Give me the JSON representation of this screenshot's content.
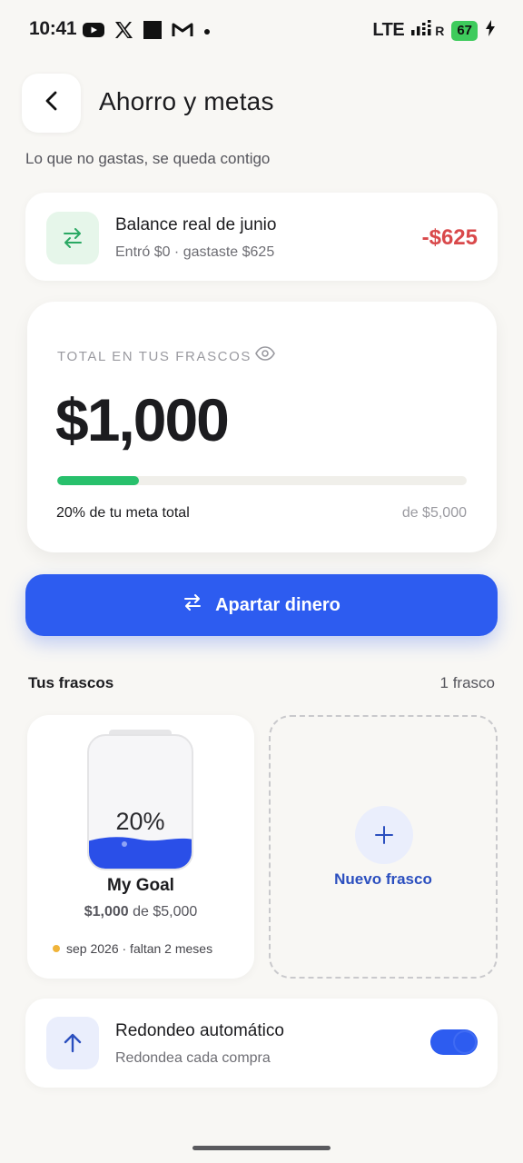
{
  "status_bar": {
    "time": "10:41",
    "network": "LTE",
    "signal_suffix": "R",
    "battery": "67",
    "icons": [
      "youtube-icon",
      "x-icon",
      "square-icon",
      "gmail-icon",
      "dot-icon",
      "signal-icon",
      "charging-icon"
    ]
  },
  "header": {
    "title": "Ahorro y metas",
    "subtitle": "Lo que no gastas, se queda contigo"
  },
  "balance": {
    "title": "Balance real de junio",
    "detail": "Entró $0 · gastaste $625",
    "amount": "-$625",
    "accent_color": "#d9494b"
  },
  "total": {
    "label": "TOTAL EN TUS FRASCOS",
    "amount": "$1,000",
    "progress_percent": 20,
    "progress_text": "20% de tu meta total",
    "goal_text": "de $5,000",
    "progress_color": "#28c06c"
  },
  "primary_action": {
    "label": "Apartar dinero",
    "color": "#2d5cf0"
  },
  "jars_section": {
    "title": "Tus frascos",
    "count": "1 frasco"
  },
  "goal": {
    "percent_label": "20%",
    "fill_fraction": 0.2,
    "name": "My Goal",
    "current": "$1,000",
    "target_text": "de $5,000",
    "date_text": "sep 2026 · faltan 2 meses"
  },
  "new_jar": {
    "label": "Nuevo frasco"
  },
  "auto_round": {
    "title": "Redondeo automático",
    "subtitle": "Redondea cada compra",
    "enabled": true
  }
}
